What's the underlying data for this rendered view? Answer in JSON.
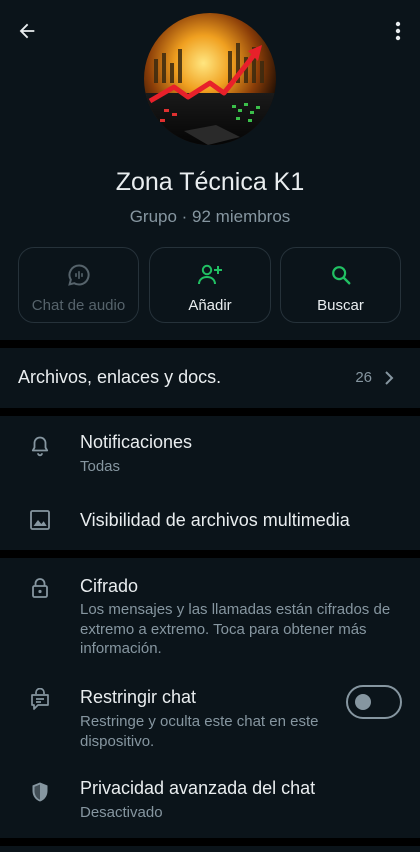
{
  "colors": {
    "background": "#000000",
    "card": "#0b141a",
    "text_primary": "#e9edef",
    "text_secondary": "#8696a0",
    "accent": "#21c063",
    "disabled": "#56636b"
  },
  "group": {
    "name": "Zona Técnica K1",
    "meta": "Grupo · 92 miembros",
    "avatar_icon": "stock-chart-avatar"
  },
  "actions": [
    {
      "label": "Chat de audio",
      "icon": "audio-chat-icon",
      "enabled": false
    },
    {
      "label": "Añadir",
      "icon": "add-person-icon",
      "enabled": true
    },
    {
      "label": "Buscar",
      "icon": "search-icon",
      "enabled": true
    }
  ],
  "files": {
    "label": "Archivos, enlaces y docs.",
    "count": "26"
  },
  "notifications": {
    "title": "Notificaciones",
    "subtitle": "Todas"
  },
  "media_visibility": {
    "title": "Visibilidad de archivos multimedia"
  },
  "encryption": {
    "title": "Cifrado",
    "subtitle": "Los mensajes y las llamadas están cifrados de extremo a extremo. Toca para obtener más información."
  },
  "restrict_chat": {
    "title": "Restringir chat",
    "subtitle": "Restringe y oculta este chat en este dispositivo.",
    "enabled": false
  },
  "advanced_privacy": {
    "title": "Privacidad avanzada del chat",
    "subtitle": "Desactivado"
  }
}
